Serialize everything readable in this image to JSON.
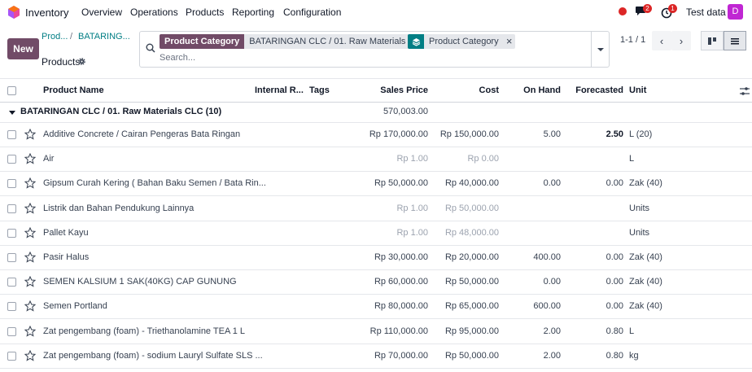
{
  "app": {
    "name": "Inventory",
    "logo_colors": [
      "#f97316",
      "#a855f7",
      "#ec4899"
    ]
  },
  "nav": {
    "items": [
      "Overview",
      "Operations",
      "Products",
      "Reporting",
      "Configuration"
    ]
  },
  "systray": {
    "messages_count": "2",
    "activities_count": "1",
    "company": "Test data",
    "avatar_letter": "D"
  },
  "toolbar": {
    "new_label": "New"
  },
  "breadcrumb": {
    "first": "Prod...",
    "separator": "/",
    "second": "BATARING..."
  },
  "page": {
    "title": "Products"
  },
  "search": {
    "facets": [
      {
        "label": "Product Category",
        "value": "BATARINGAN CLC / 01. Raw Materials CLC"
      },
      {
        "icon": "layers-icon",
        "value": "Product Category"
      }
    ],
    "placeholder": "Search..."
  },
  "pager": {
    "text": "1-1 / 1",
    "prev": "‹",
    "next": "›"
  },
  "table": {
    "columns": {
      "name": "Product Name",
      "internal_ref": "Internal R...",
      "tags": "Tags",
      "sales_price": "Sales Price",
      "cost": "Cost",
      "on_hand": "On Hand",
      "forecasted": "Forecasted",
      "unit": "Unit"
    },
    "group": {
      "label": "BATARINGAN CLC / 01. Raw Materials CLC (10)",
      "sales_total": "570,003.00"
    },
    "rows": [
      {
        "name": "Additive Concrete / Cairan Pengeras Bata Ringan",
        "sales_price": "Rp 170,000.00",
        "cost": "Rp 150,000.00",
        "on_hand": "5.00",
        "forecasted": "2.50",
        "unit": "L (20)",
        "price_muted": false,
        "forecast_bold": true
      },
      {
        "name": "Air",
        "sales_price": "Rp 1.00",
        "cost": "Rp 0.00",
        "on_hand": "",
        "forecasted": "",
        "unit": "L",
        "price_muted": true,
        "forecast_bold": false
      },
      {
        "name": "Gipsum Curah Kering ( Bahan Baku Semen / Bata Rin...",
        "sales_price": "Rp 50,000.00",
        "cost": "Rp 40,000.00",
        "on_hand": "0.00",
        "forecasted": "0.00",
        "unit": "Zak (40)",
        "price_muted": false,
        "forecast_bold": false
      },
      {
        "name": "Listrik dan Bahan Pendukung Lainnya",
        "sales_price": "Rp 1.00",
        "cost": "Rp 50,000.00",
        "on_hand": "",
        "forecasted": "",
        "unit": "Units",
        "price_muted": true,
        "forecast_bold": false
      },
      {
        "name": "Pallet Kayu",
        "sales_price": "Rp 1.00",
        "cost": "Rp 48,000.00",
        "on_hand": "",
        "forecasted": "",
        "unit": "Units",
        "price_muted": true,
        "forecast_bold": false
      },
      {
        "name": "Pasir Halus",
        "sales_price": "Rp 30,000.00",
        "cost": "Rp 20,000.00",
        "on_hand": "400.00",
        "forecasted": "0.00",
        "unit": "Zak (40)",
        "price_muted": false,
        "forecast_bold": false
      },
      {
        "name": "SEMEN KALSIUM 1 SAK(40KG) CAP GUNUNG",
        "sales_price": "Rp 60,000.00",
        "cost": "Rp 50,000.00",
        "on_hand": "0.00",
        "forecasted": "0.00",
        "unit": "Zak (40)",
        "price_muted": false,
        "forecast_bold": false
      },
      {
        "name": "Semen Portland",
        "sales_price": "Rp 80,000.00",
        "cost": "Rp 65,000.00",
        "on_hand": "600.00",
        "forecasted": "0.00",
        "unit": "Zak (40)",
        "price_muted": false,
        "forecast_bold": false
      },
      {
        "name": "Zat pengembang (foam) - Triethanolamine TEA 1 L",
        "sales_price": "Rp 110,000.00",
        "cost": "Rp 95,000.00",
        "on_hand": "2.00",
        "forecasted": "0.80",
        "unit": "L",
        "price_muted": false,
        "forecast_bold": false
      },
      {
        "name": "Zat pengembang (foam) - sodium Lauryl Sulfate SLS ...",
        "sales_price": "Rp 70,000.00",
        "cost": "Rp 50,000.00",
        "on_hand": "2.00",
        "forecasted": "0.80",
        "unit": "kg",
        "price_muted": false,
        "forecast_bold": false
      }
    ]
  },
  "colors": {
    "brand": "#714b67",
    "link": "#017e84",
    "alert": "#dc2626",
    "avatar": "#c026d3"
  }
}
